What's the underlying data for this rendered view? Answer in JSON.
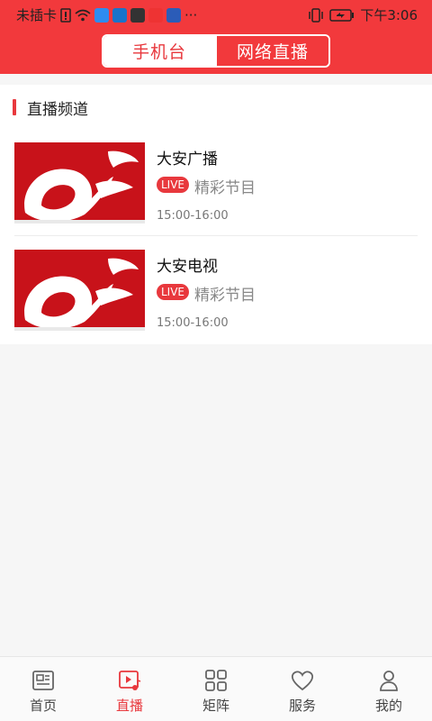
{
  "status_bar": {
    "carrier": "未插卡",
    "more": "···",
    "time": "下午3:06"
  },
  "segmented": {
    "left_label": "手机台",
    "right_label": "网络直播"
  },
  "section": {
    "title": "直播频道"
  },
  "channels": [
    {
      "name": "大安广播",
      "badge": "LIVE",
      "program": "精彩节目",
      "time": "15:00-16:00"
    },
    {
      "name": "大安电视",
      "badge": "LIVE",
      "program": "精彩节目",
      "time": "15:00-16:00"
    }
  ],
  "tabs": [
    {
      "label": "首页",
      "icon": "news-icon"
    },
    {
      "label": "直播",
      "icon": "live-video-icon"
    },
    {
      "label": "矩阵",
      "icon": "grid-icon"
    },
    {
      "label": "服务",
      "icon": "heart-icon"
    },
    {
      "label": "我的",
      "icon": "person-icon"
    }
  ],
  "colors": {
    "brand_red": "#f2393c",
    "accent_red": "#e8383d",
    "thumb_red": "#c8121a"
  }
}
